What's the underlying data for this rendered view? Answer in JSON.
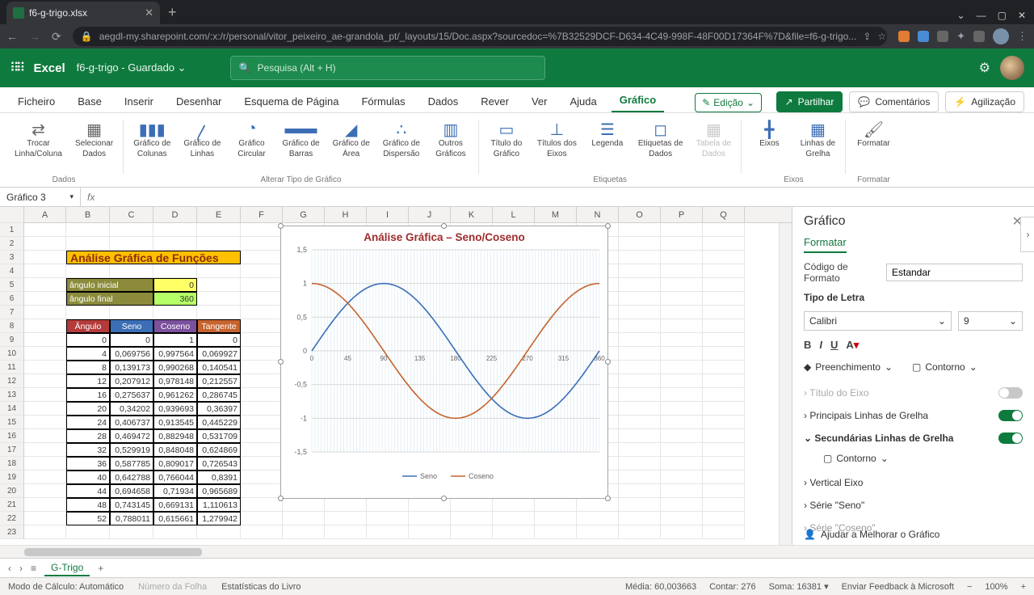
{
  "browser": {
    "tab_title": "f6-g-trigo.xlsx",
    "url": "aegdl-my.sharepoint.com/:x:/r/personal/vitor_peixeiro_ae-grandola_pt/_layouts/15/Doc.aspx?sourcedoc=%7B32529DCF-D634-4C49-998F-48F00D17364F%7D&file=f6-g-trigo..."
  },
  "excel_header": {
    "brand": "Excel",
    "doc": "f6-g-trigo - Guardado",
    "search_placeholder": "Pesquisa (Alt + H)"
  },
  "ribbon_tabs": [
    "Ficheiro",
    "Base",
    "Inserir",
    "Desenhar",
    "Esquema de Página",
    "Fórmulas",
    "Dados",
    "Rever",
    "Ver",
    "Ajuda",
    "Gráfico"
  ],
  "ribbon_active": "Gráfico",
  "ribbon_edit": "Edição",
  "ribbon_right": {
    "share": "Partilhar",
    "comments": "Comentários",
    "agil": "Agilização"
  },
  "ribbon_groups": {
    "g1": {
      "btns": [
        [
          "Trocar",
          "Linha/Coluna"
        ],
        [
          "Selecionar",
          "Dados"
        ]
      ],
      "label": "Dados"
    },
    "g2": {
      "btns": [
        [
          "Gráfico de",
          "Colunas"
        ],
        [
          "Gráfico de",
          "Linhas"
        ],
        [
          "Gráfico",
          "Circular"
        ],
        [
          "Gráfico de",
          "Barras"
        ],
        [
          "Gráfico de",
          "Área"
        ],
        [
          "Gráfico de",
          "Dispersão"
        ],
        [
          "Outros",
          "Gráficos"
        ]
      ],
      "label": "Alterar Tipo de Gráfico"
    },
    "g3": {
      "btns": [
        [
          "Título do",
          "Gráfico"
        ],
        [
          "Títulos dos",
          "Eixos"
        ],
        [
          "Legenda",
          ""
        ],
        [
          "Etiquetas de",
          "Dados"
        ],
        [
          "Tabela de",
          "Dados"
        ]
      ],
      "label": "Etiquetas"
    },
    "g4": {
      "btns": [
        [
          "Eixos",
          ""
        ],
        [
          "Linhas de",
          "Grelha"
        ]
      ],
      "label": "Eixos"
    },
    "g5": {
      "btns": [
        [
          "Formatar",
          ""
        ]
      ],
      "label": "Formatar"
    }
  },
  "formula_bar": {
    "name": "Gráfico 3",
    "fx": "fx"
  },
  "columns": [
    "A",
    "B",
    "C",
    "D",
    "E",
    "F",
    "G",
    "H",
    "I",
    "J",
    "K",
    "L",
    "M",
    "N",
    "O",
    "P",
    "Q"
  ],
  "sheet": {
    "title": "Análise Gráfica de Funções",
    "params": [
      {
        "label": "ângulo inicial",
        "value": "0"
      },
      {
        "label": "ângulo final",
        "value": "360"
      }
    ],
    "headers": [
      "Ângulo",
      "Seno",
      "Coseno",
      "Tangente"
    ],
    "rows": [
      [
        "0",
        "0",
        "1",
        "0"
      ],
      [
        "4",
        "0,069756",
        "0,997564",
        "0,069927"
      ],
      [
        "8",
        "0,139173",
        "0,990268",
        "0,140541"
      ],
      [
        "12",
        "0,207912",
        "0,978148",
        "0,212557"
      ],
      [
        "16",
        "0,275637",
        "0,961262",
        "0,286745"
      ],
      [
        "20",
        "0,34202",
        "0,939693",
        "0,36397"
      ],
      [
        "24",
        "0,406737",
        "0,913545",
        "0,445229"
      ],
      [
        "28",
        "0,469472",
        "0,882948",
        "0,531709"
      ],
      [
        "32",
        "0,529919",
        "0,848048",
        "0,624869"
      ],
      [
        "36",
        "0,587785",
        "0,809017",
        "0,726543"
      ],
      [
        "40",
        "0,642788",
        "0,766044",
        "0,8391"
      ],
      [
        "44",
        "0,694658",
        "0,71934",
        "0,965689"
      ],
      [
        "48",
        "0,743145",
        "0,669131",
        "1,110613"
      ],
      [
        "52",
        "0,788011",
        "0,615661",
        "1,279942"
      ]
    ]
  },
  "chart_data": {
    "type": "line",
    "title": "Análise Gráfica – Seno/Coseno",
    "xlabel": "",
    "ylabel": "",
    "xlim": [
      0,
      360
    ],
    "ylim": [
      -1.5,
      1.5
    ],
    "xticks": [
      0,
      45,
      90,
      135,
      180,
      225,
      270,
      315,
      360
    ],
    "yticks": [
      -1.5,
      -1,
      -0.5,
      0,
      0.5,
      1,
      1.5
    ],
    "series": [
      {
        "name": "Seno",
        "color": "#3b6eb5",
        "x": [
          0,
          45,
          90,
          135,
          180,
          225,
          270,
          315,
          360
        ],
        "y": [
          0,
          0.707,
          1,
          0.707,
          0,
          -0.707,
          -1,
          -0.707,
          0
        ]
      },
      {
        "name": "Coseno",
        "color": "#c6632e",
        "x": [
          0,
          45,
          90,
          135,
          180,
          225,
          270,
          315,
          360
        ],
        "y": [
          1,
          0.707,
          0,
          -0.707,
          -1,
          -0.707,
          0,
          0.707,
          1
        ]
      }
    ],
    "legend": [
      "Seno",
      "Coseno"
    ]
  },
  "side_pane": {
    "title": "Gráfico",
    "tab": "Formatar",
    "format_code_lbl": "Código de Formato",
    "format_code_val": "Estandar",
    "font_lbl": "Tipo de Letra",
    "font_name": "Calibri",
    "font_size": "9",
    "fill": "Preenchimento",
    "outline": "Contorno",
    "items": {
      "axis_title": "Título do Eixo",
      "major_grid": "Principais Linhas de Grelha",
      "minor_grid": "Secundárias Linhas de Grelha",
      "contour": "Contorno",
      "v_axis": "Vertical Eixo",
      "series_seno": "Série \"Seno\"",
      "series_coseno": "Série \"Coseno\""
    },
    "help": "Ajudar a Melhorar o Gráfico"
  },
  "sheet_tab": "G-Trigo",
  "status_bar": {
    "calc": "Modo de Cálculo: Automático",
    "sheetnum": "Número da Folha",
    "stats": "Estatísticas do Livro",
    "avg": "Média: 60,003663",
    "count": "Contar: 276",
    "sum": "Soma: 16381",
    "feedback": "Enviar Feedback à Microsoft",
    "zoom": "100%"
  }
}
